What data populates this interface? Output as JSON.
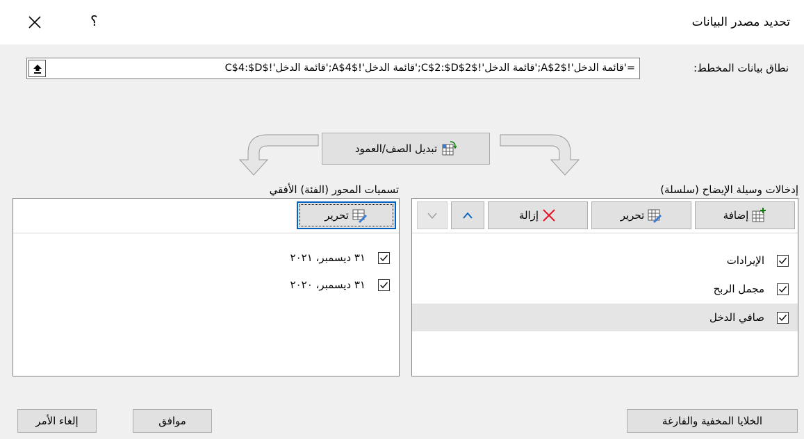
{
  "window": {
    "title": "تحديد مصدر البيانات",
    "help_label": "؟"
  },
  "range": {
    "label": "نطاق بيانات المخطط:",
    "value": "='قائمة الدخل'!$A$2;'قائمة الدخل'!$C$2:$D$2;'قائمة الدخل'!$A$4;'قائمة الدخل'!$C$4:$D"
  },
  "switch_button": {
    "label": "تبديل الصف/العمود"
  },
  "legend": {
    "label": "إدخالات وسيلة الإيضاح (سلسلة)",
    "add_label": "إضافة",
    "edit_label": "تحرير",
    "remove_label": "إزالة",
    "items": [
      {
        "label": "الإيرادات",
        "checked": true,
        "selected": false
      },
      {
        "label": "مجمل الربح",
        "checked": true,
        "selected": false
      },
      {
        "label": "صافي الدخل",
        "checked": true,
        "selected": true
      }
    ]
  },
  "axis": {
    "label": "تسميات المحور (الفئة) الأفقي",
    "edit_label": "تحرير",
    "items": [
      {
        "label": "٣١ ديسمبر، ٢٠٢١",
        "checked": true
      },
      {
        "label": "٣١ ديسمبر، ٢٠٢٠",
        "checked": true
      }
    ]
  },
  "footer": {
    "hidden_cells_label": "الخلايا المخفية والفارغة",
    "ok_label": "موافق",
    "cancel_label": "إلغاء الأمر"
  },
  "colors": {
    "accent": "#0060c0",
    "remove_red": "#e81123",
    "add_green": "#107c10"
  }
}
